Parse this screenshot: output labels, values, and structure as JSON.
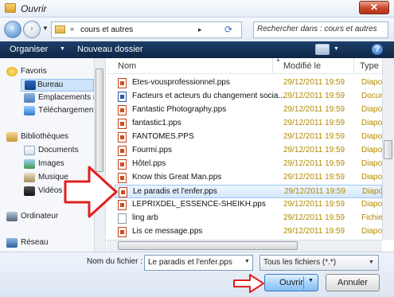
{
  "window": {
    "title": "Ouvrir",
    "close_symbol": "✕"
  },
  "address": {
    "breadcrumb": "cours et autres",
    "search_placeholder": "Rechercher dans : cours et autres"
  },
  "toolbar": {
    "organize_label": "Organiser",
    "new_folder_label": "Nouveau dossier",
    "help_symbol": "?"
  },
  "navigation": {
    "favorites_label": "Favoris",
    "items": [
      {
        "label": "Bureau",
        "icon": "desktop-icon"
      },
      {
        "label": "Emplacements ré",
        "icon": "recent-places-icon"
      },
      {
        "label": "Téléchargements",
        "icon": "downloads-icon"
      }
    ],
    "libraries_label": "Bibliothèques",
    "library_items": [
      {
        "label": "Documents",
        "icon": "documents-icon"
      },
      {
        "label": "Images",
        "icon": "pictures-icon"
      },
      {
        "label": "Musique",
        "icon": "music-icon"
      },
      {
        "label": "Vidéos",
        "icon": "videos-icon"
      }
    ],
    "computer_label": "Ordinateur",
    "network_label": "Réseau"
  },
  "columns": {
    "name": "Nom",
    "modified": "Modifié le",
    "type": "Type"
  },
  "files": [
    {
      "name": "Etes-vousprofessionnel.pps",
      "date": "29/12/2011 19:59",
      "type": "Diapor",
      "kind": "pps"
    },
    {
      "name": "Facteurs et acteurs du changement socia...",
      "date": "29/12/2011 19:59",
      "type": "Docur",
      "kind": "word"
    },
    {
      "name": "Fantastic Photography.pps",
      "date": "29/12/2011 19:59",
      "type": "Diapor",
      "kind": "pps"
    },
    {
      "name": "fantastic1.pps",
      "date": "29/12/2011 19:59",
      "type": "Diapor",
      "kind": "pps"
    },
    {
      "name": "FANTOMES.PPS",
      "date": "29/12/2011 19:59",
      "type": "Diapor",
      "kind": "pps"
    },
    {
      "name": "Fourmi.pps",
      "date": "29/12/2011 19:59",
      "type": "Diapor",
      "kind": "pps"
    },
    {
      "name": "Hôtel.pps",
      "date": "29/12/2011 19:59",
      "type": "Diapor",
      "kind": "pps"
    },
    {
      "name": "Know this Great Man.pps",
      "date": "29/12/2011 19:59",
      "type": "Diapor",
      "kind": "pps"
    },
    {
      "name": "Le paradis et l'enfer.pps",
      "date": "29/12/2011 19:59",
      "type": "Diapor",
      "kind": "pps",
      "selected": true
    },
    {
      "name": "LEPRIXDEL_ESSENCE-SHEIKH.pps",
      "date": "29/12/2011 19:59",
      "type": "Diapor",
      "kind": "pps"
    },
    {
      "name": "ling arb",
      "date": "29/12/2011 19:59",
      "type": "Fichie",
      "kind": "blank"
    },
    {
      "name": "Lis ce message.pps",
      "date": "29/12/2011 19:59",
      "type": "Diapor",
      "kind": "pps"
    }
  ],
  "footer": {
    "filename_label": "Nom du fichier :",
    "filename_value": "Le paradis et l'enfer.pps",
    "filetype_value": "Tous les fichiers (*.*)",
    "open_label": "Ouvrir",
    "cancel_label": "Annuler"
  },
  "colors": {
    "accent": "#0e2645",
    "date_text": "#b38a00",
    "annotation_arrow": "#e02020"
  }
}
